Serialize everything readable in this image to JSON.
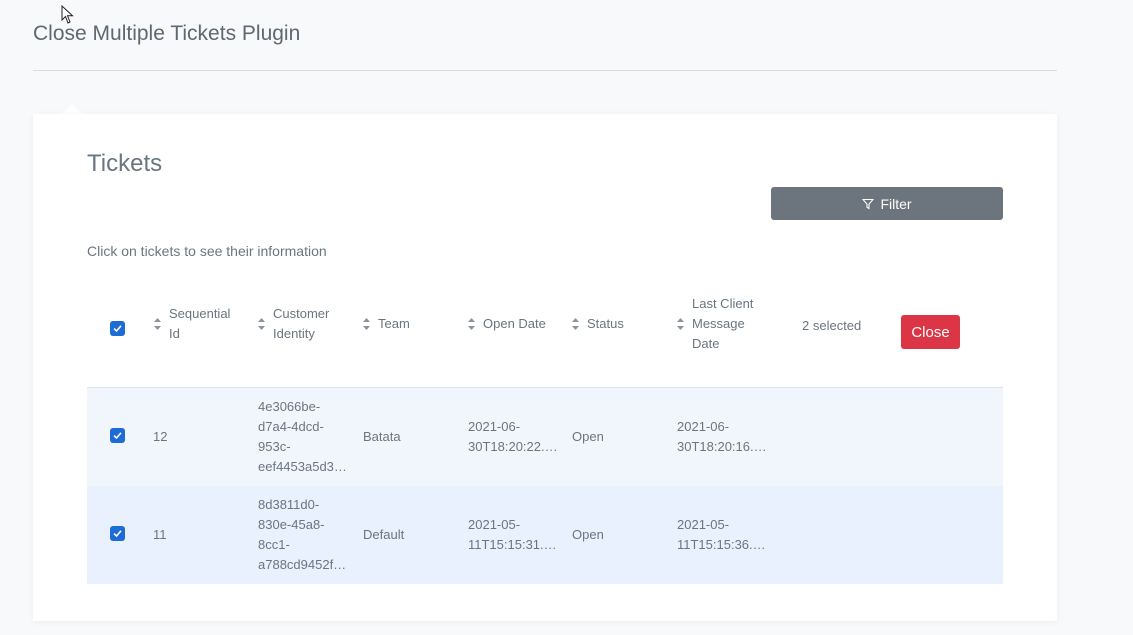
{
  "page": {
    "title": "Close Multiple Tickets Plugin"
  },
  "card": {
    "title": "Tickets",
    "filter_label": "Filter",
    "hint": "Click on tickets to see their information"
  },
  "table": {
    "columns": [
      {
        "line1": "Sequential",
        "line2": "Id",
        "line3": ""
      },
      {
        "line1": "Customer",
        "line2": "Identity",
        "line3": ""
      },
      {
        "line1": "Team",
        "line2": "",
        "line3": ""
      },
      {
        "line1": "Open Date",
        "line2": "",
        "line3": ""
      },
      {
        "line1": "Status",
        "line2": "",
        "line3": ""
      },
      {
        "line1": "Last Client",
        "line2": "Message",
        "line3": "Date"
      }
    ],
    "selected_count": "2 selected",
    "close_label": "Close",
    "rows": [
      {
        "checked": true,
        "id": "12",
        "customer_identity": "4e3066be-\nd7a4-4dcd-\n953c-\neef4453a5d3…",
        "team": "Batata",
        "open_date": "2021-06-\n30T18:20:22.…",
        "status": "Open",
        "last_message_date": "2021-06-\n30T18:20:16.…"
      },
      {
        "checked": true,
        "id": "11",
        "customer_identity": "8d3811d0-\n830e-45a8-\n8cc1-\na788cd9452f…",
        "team": "Default",
        "open_date": "2021-05-\n11T15:15:31.…",
        "status": "Open",
        "last_message_date": "2021-05-\n11T15:15:36.…"
      }
    ]
  },
  "colors": {
    "primary_checkbox": "#1c6bd6",
    "close_button": "#dc3545",
    "filter_button": "#6c757d",
    "row_highlight": "#e8f1fd"
  },
  "icons": [
    "cursor-icon",
    "filter-icon",
    "sort-icon",
    "checkmark-icon"
  ]
}
